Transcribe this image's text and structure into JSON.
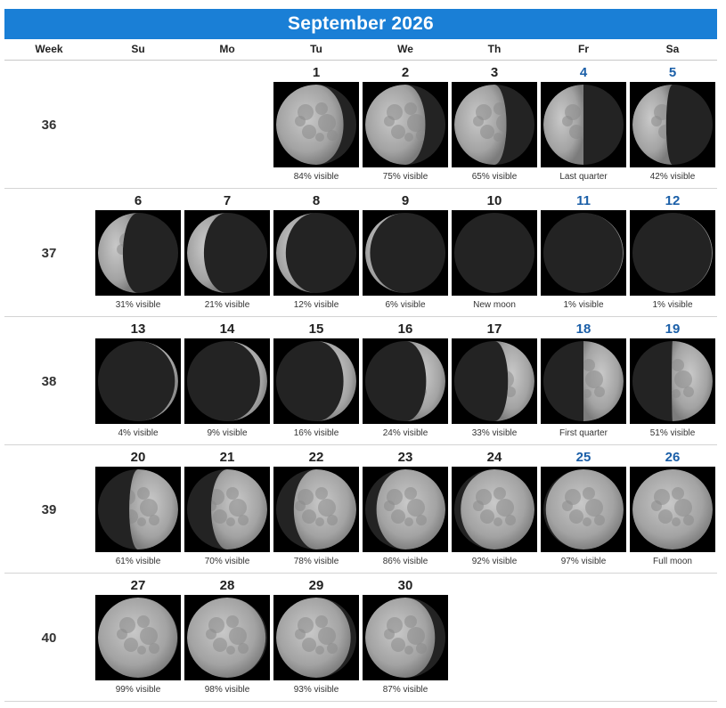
{
  "title": "September 2026",
  "headers": [
    "Week",
    "Su",
    "Mo",
    "Tu",
    "We",
    "Th",
    "Fr",
    "Sa"
  ],
  "colors": {
    "title_bg": "#1a7fd6",
    "weekend_number": "#1b5fa8"
  },
  "weeks": [
    {
      "week": "36",
      "days": [
        null,
        null,
        {
          "day": "1",
          "label": "84% visible",
          "illum": 0.84,
          "waxing": false
        },
        {
          "day": "2",
          "label": "75% visible",
          "illum": 0.75,
          "waxing": false
        },
        {
          "day": "3",
          "label": "65% visible",
          "illum": 0.65,
          "waxing": false
        },
        {
          "day": "4",
          "label": "Last quarter",
          "illum": 0.5,
          "waxing": false
        },
        {
          "day": "5",
          "label": "42% visible",
          "illum": 0.42,
          "waxing": false
        }
      ]
    },
    {
      "week": "37",
      "days": [
        {
          "day": "6",
          "label": "31% visible",
          "illum": 0.31,
          "waxing": false
        },
        {
          "day": "7",
          "label": "21% visible",
          "illum": 0.21,
          "waxing": false
        },
        {
          "day": "8",
          "label": "12% visible",
          "illum": 0.12,
          "waxing": false
        },
        {
          "day": "9",
          "label": "6% visible",
          "illum": 0.06,
          "waxing": false
        },
        {
          "day": "10",
          "label": "New moon",
          "illum": 0.0,
          "waxing": false
        },
        {
          "day": "11",
          "label": "1% visible",
          "illum": 0.01,
          "waxing": true
        },
        {
          "day": "12",
          "label": "1% visible",
          "illum": 0.01,
          "waxing": true
        }
      ]
    },
    {
      "week": "38",
      "days": [
        {
          "day": "13",
          "label": "4% visible",
          "illum": 0.04,
          "waxing": true
        },
        {
          "day": "14",
          "label": "9% visible",
          "illum": 0.09,
          "waxing": true
        },
        {
          "day": "15",
          "label": "16% visible",
          "illum": 0.16,
          "waxing": true
        },
        {
          "day": "16",
          "label": "24% visible",
          "illum": 0.24,
          "waxing": true
        },
        {
          "day": "17",
          "label": "33% visible",
          "illum": 0.33,
          "waxing": true
        },
        {
          "day": "18",
          "label": "First quarter",
          "illum": 0.5,
          "waxing": true
        },
        {
          "day": "19",
          "label": "51% visible",
          "illum": 0.51,
          "waxing": true
        }
      ]
    },
    {
      "week": "39",
      "days": [
        {
          "day": "20",
          "label": "61% visible",
          "illum": 0.61,
          "waxing": true
        },
        {
          "day": "21",
          "label": "70% visible",
          "illum": 0.7,
          "waxing": true
        },
        {
          "day": "22",
          "label": "78% visible",
          "illum": 0.78,
          "waxing": true
        },
        {
          "day": "23",
          "label": "86% visible",
          "illum": 0.86,
          "waxing": true
        },
        {
          "day": "24",
          "label": "92% visible",
          "illum": 0.92,
          "waxing": true
        },
        {
          "day": "25",
          "label": "97% visible",
          "illum": 0.97,
          "waxing": true
        },
        {
          "day": "26",
          "label": "Full moon",
          "illum": 1.0,
          "waxing": true
        }
      ]
    },
    {
      "week": "40",
      "days": [
        {
          "day": "27",
          "label": "99% visible",
          "illum": 0.99,
          "waxing": false
        },
        {
          "day": "28",
          "label": "98% visible",
          "illum": 0.98,
          "waxing": false
        },
        {
          "day": "29",
          "label": "93% visible",
          "illum": 0.93,
          "waxing": false
        },
        {
          "day": "30",
          "label": "87% visible",
          "illum": 0.87,
          "waxing": false
        },
        null,
        null,
        null
      ]
    }
  ]
}
